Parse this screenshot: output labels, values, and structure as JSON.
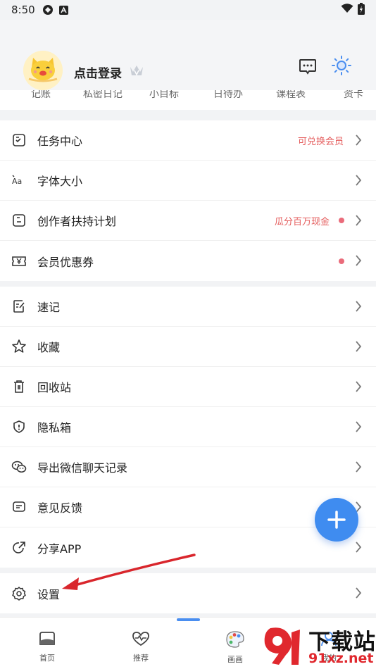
{
  "status_bar": {
    "time": "8:50"
  },
  "header": {
    "login_label": "点击登录"
  },
  "quick_links": [
    "记账",
    "私密日记",
    "小目标",
    "日待办",
    "课程表",
    "资卡"
  ],
  "section1": [
    {
      "label": "任务中心",
      "icon": "task-icon",
      "tag": "可兑换会员",
      "dot": false
    },
    {
      "label": "字体大小",
      "icon": "font-size-icon",
      "tag": "",
      "dot": false
    },
    {
      "label": "创作者扶持计划",
      "icon": "creator-icon",
      "tag": "瓜分百万现金",
      "dot": true
    },
    {
      "label": "会员优惠券",
      "icon": "coupon-icon",
      "tag": "",
      "dot": true
    }
  ],
  "section2": [
    {
      "label": "速记",
      "icon": "quick-note-icon"
    },
    {
      "label": "收藏",
      "icon": "star-icon"
    },
    {
      "label": "回收站",
      "icon": "trash-icon"
    },
    {
      "label": "隐私箱",
      "icon": "shield-icon"
    },
    {
      "label": "导出微信聊天记录",
      "icon": "wechat-icon"
    },
    {
      "label": "意见反馈",
      "icon": "feedback-icon"
    },
    {
      "label": "分享APP",
      "icon": "share-icon"
    }
  ],
  "section3": [
    {
      "label": "设置",
      "icon": "gear-icon"
    }
  ],
  "bottom_nav": [
    {
      "label": "首页",
      "icon": "home-icon"
    },
    {
      "label": "推荐",
      "icon": "heart-pulse-icon"
    },
    {
      "label": "画画",
      "icon": "palette-icon"
    },
    {
      "label": "我的",
      "icon": "profile-icon"
    }
  ],
  "watermark": {
    "line1": "下载站",
    "line2": "91xz.net"
  },
  "colors": {
    "accent": "#3f8cf0",
    "tag_red": "#e45b5b",
    "arrow_red": "#d9262c"
  }
}
